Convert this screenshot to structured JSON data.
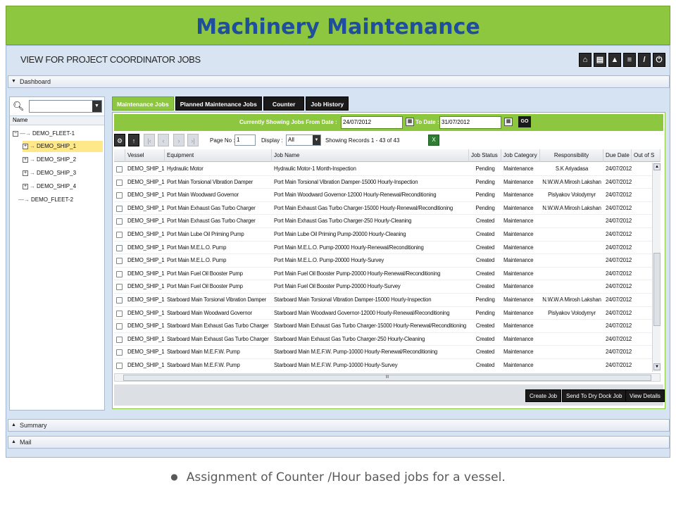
{
  "title": "Machinery Maintenance",
  "app": {
    "header_title": "VIEW FOR PROJECT COORDINATOR JOBS",
    "toolbar_icons": [
      "home-icon",
      "print-icon",
      "alert-icon",
      "document-icon",
      "edit-icon",
      "power-icon"
    ],
    "dashboard_label": "Dashboard",
    "summary_label": "Summary",
    "mail_label": "Mail"
  },
  "tree": {
    "header": "Name",
    "nodes": [
      {
        "label": "DEMO_FLEET-1",
        "level": 0,
        "expanded": true
      },
      {
        "label": "DEMO_SHIP_1",
        "level": 1,
        "selected": true
      },
      {
        "label": "DEMO_SHIP_2",
        "level": 1
      },
      {
        "label": "DEMO_SHIP_3",
        "level": 1
      },
      {
        "label": "DEMO_SHIP_4",
        "level": 1
      },
      {
        "label": "DEMO_FLEET-2",
        "level": 0
      }
    ]
  },
  "tabs": [
    "Maintenance Jobs",
    "Planned Maintenance Jobs",
    "Counter",
    "Job History"
  ],
  "date_filter": {
    "from_label": "Currently Showing Jobs From Date :",
    "from_value": "24/07/2012",
    "to_label": "To Date :",
    "to_value": "31/07/2012",
    "go_label": "GO"
  },
  "pager": {
    "page_label": "Page No :",
    "page_value": "1",
    "display_label": "Display :",
    "display_value": "All",
    "records_text": "Showing Records 1 - 43 of 43"
  },
  "columns": [
    "Vessel",
    "Equipment",
    "Job Name",
    "Job Status",
    "Job Category",
    "Responsibility",
    "Due Date",
    "Out of S"
  ],
  "rows": [
    [
      "DEMO_SHIP_1",
      "Hydraulic Motor",
      "Hydraulic Motor-1 Month-Inspection",
      "Pending",
      "Maintenance",
      "S.K Ariyadasa",
      "24/07/2012"
    ],
    [
      "DEMO_SHIP_1",
      "Port Main Torsional Vibration Damper",
      "Port Main Torsional Vibration Damper-15000 Hourly-Inspection",
      "Pending",
      "Maintenance",
      "N.W.W.A Mirosh Lakshan",
      "24/07/2012"
    ],
    [
      "DEMO_SHIP_1",
      "Port Main Woodward Governor",
      "Port Main Woodward Governor-12000 Hourly-Renewal/Reconditioning",
      "Pending",
      "Maintenance",
      "Pislyakov Volodymyr",
      "24/07/2012"
    ],
    [
      "DEMO_SHIP_1",
      "Port Main Exhaust Gas Turbo Charger",
      "Port Main Exhaust Gas Turbo Charger-15000 Hourly-Renewal/Reconditioning",
      "Pending",
      "Maintenance",
      "N.W.W.A Mirosh Lakshan",
      "24/07/2012"
    ],
    [
      "DEMO_SHIP_1",
      "Port Main Exhaust Gas Turbo Charger",
      "Port Main Exhaust Gas Turbo Charger-250 Hourly-Cleaning",
      "Created",
      "Maintenance",
      "",
      "24/07/2012"
    ],
    [
      "DEMO_SHIP_1",
      "Port Main Lube Oil Priming Pump",
      "Port Main Lube Oil Priming Pump-20000 Hourly-Cleaning",
      "Created",
      "Maintenance",
      "",
      "24/07/2012"
    ],
    [
      "DEMO_SHIP_1",
      "Port Main M.E.L.O. Pump",
      "Port Main M.E.L.O. Pump-20000 Hourly-Renewal/Reconditioning",
      "Created",
      "Maintenance",
      "",
      "24/07/2012"
    ],
    [
      "DEMO_SHIP_1",
      "Port Main M.E.L.O. Pump",
      "Port Main M.E.L.O. Pump-20000 Hourly-Survey",
      "Created",
      "Maintenance",
      "",
      "24/07/2012"
    ],
    [
      "DEMO_SHIP_1",
      "Port Main Fuel Oil Booster Pump",
      "Port Main Fuel Oil Booster Pump-20000 Hourly-Renewal/Reconditioning",
      "Created",
      "Maintenance",
      "",
      "24/07/2012"
    ],
    [
      "DEMO_SHIP_1",
      "Port Main Fuel Oil Booster Pump",
      "Port Main Fuel Oil Booster Pump-20000 Hourly-Survey",
      "Created",
      "Maintenance",
      "",
      "24/07/2012"
    ],
    [
      "DEMO_SHIP_1",
      "Starboard Main Torsional Vibration Damper",
      "Starboard Main Torsional Vibration Damper-15000 Hourly-Inspection",
      "Pending",
      "Maintenance",
      "N.W.W.A Mirosh Lakshan",
      "24/07/2012"
    ],
    [
      "DEMO_SHIP_1",
      "Starboard Main Woodward Governor",
      "Starboard Main Woodward Governor-12000 Hourly-Renewal/Reconditioning",
      "Pending",
      "Maintenance",
      "Pislyakov Volodymyr",
      "24/07/2012"
    ],
    [
      "DEMO_SHIP_1",
      "Starboard Main Exhaust Gas Turbo Charger",
      "Starboard Main Exhaust Gas Turbo Charger-15000 Hourly-Renewal/Reconditioning",
      "Created",
      "Maintenance",
      "",
      "24/07/2012"
    ],
    [
      "DEMO_SHIP_1",
      "Starboard Main Exhaust Gas Turbo Charger",
      "Starboard Main Exhaust Gas Turbo Charger-250 Hourly-Cleaning",
      "Created",
      "Maintenance",
      "",
      "24/07/2012"
    ],
    [
      "DEMO_SHIP_1",
      "Starboard Main M.E.F.W. Pump",
      "Starboard Main M.E.F.W. Pump-10000 Hourly-Renewal/Reconditioning",
      "Created",
      "Maintenance",
      "",
      "24/07/2012"
    ],
    [
      "DEMO_SHIP_1",
      "Starboard Main M.E.F.W. Pump",
      "Starboard Main M.E.F.W. Pump-10000 Hourly-Survey",
      "Created",
      "Maintenance",
      "",
      "24/07/2012"
    ]
  ],
  "actions": [
    "Create Job",
    "Send To Dry Dock Job",
    "View Details"
  ],
  "caption": "Assignment of Counter /Hour based jobs for a vessel.",
  "colors": {
    "brand_green": "#8dc63f",
    "title_blue": "#1f4e9c",
    "dark": "#1a1a1a"
  }
}
